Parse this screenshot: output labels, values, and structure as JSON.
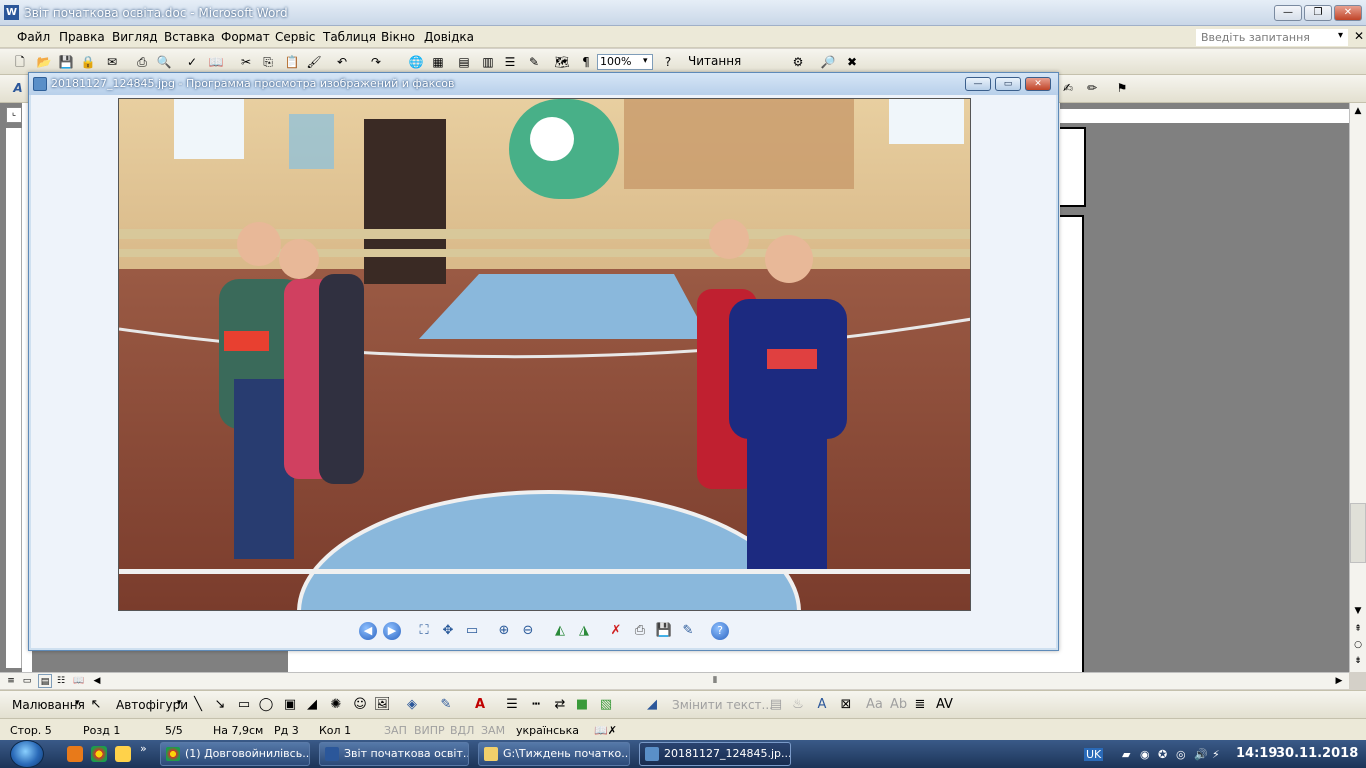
{
  "word": {
    "title": "Звіт початкова освіта.doc - Microsoft Word",
    "menu": [
      "Файл",
      "Правка",
      "Вигляд",
      "Вставка",
      "Формат",
      "Сервіс",
      "Таблиця",
      "Вікно",
      "Довідка"
    ],
    "help_placeholder": "Введіть запитання",
    "zoom": "100%",
    "read_button": "Читання"
  },
  "viewer": {
    "title": "20181127_124845.jpg - Программа просмотра изображений и факсов"
  },
  "drawbar": {
    "drawing": "Малювання",
    "autoshapes": "Автофігури",
    "change_text": "Змінити текст..."
  },
  "status": {
    "page": "Стор.  5",
    "section": "Розд  1",
    "pages": "5/5",
    "at": "На  7,9см",
    "line": "Рд  3",
    "col": "Кол  1",
    "rec": "ЗАП",
    "trk": "ВИПР",
    "ext": "ВДЛ",
    "ovr": "ЗАМ",
    "language": "українська"
  },
  "taskbar": {
    "items": [
      "(1) Довговойнилівсь...",
      "Звіт початкова освіт...",
      "G:\\Тиждень початко...",
      "20181127_124845.jp..."
    ],
    "lang": "UK",
    "time": "14:19",
    "date": "30.11.2018"
  },
  "colors": {
    "word_blue": "#2b579a",
    "taskbar": "#1c3458",
    "viewer_frame": "#5e8ab8"
  }
}
